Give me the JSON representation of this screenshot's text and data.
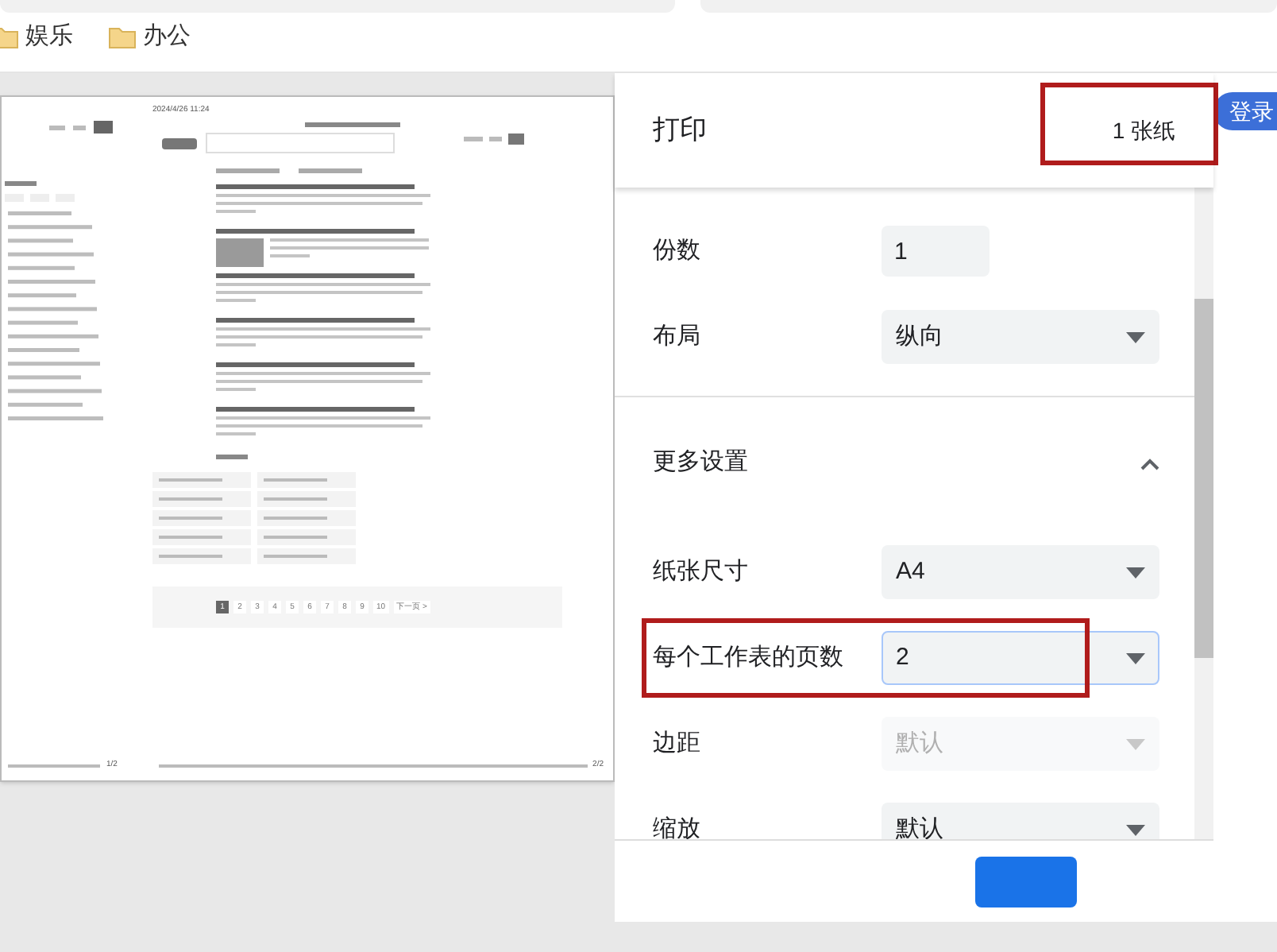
{
  "browser": {
    "bookmarks": [
      {
        "label": "娱乐"
      },
      {
        "label": "办公"
      }
    ],
    "login_button": "登录"
  },
  "preview": {
    "timestamp": "2024/4/26 11:24",
    "pagination": [
      {
        "label": "1",
        "selected": true
      },
      {
        "label": "2",
        "selected": false
      },
      {
        "label": "3",
        "selected": false
      },
      {
        "label": "4",
        "selected": false
      },
      {
        "label": "5",
        "selected": false
      },
      {
        "label": "6",
        "selected": false
      },
      {
        "label": "7",
        "selected": false
      },
      {
        "label": "8",
        "selected": false
      },
      {
        "label": "9",
        "selected": false
      },
      {
        "label": "10",
        "selected": false
      },
      {
        "label": "下一页 >",
        "selected": false
      }
    ],
    "page_numbers": [
      "1/2",
      "2/2"
    ]
  },
  "print_panel": {
    "title": "打印",
    "sheet_count": "1 张纸",
    "settings": [
      {
        "kind": "input",
        "label": "份数",
        "value": "1"
      },
      {
        "kind": "select",
        "label": "布局",
        "value": "纵向",
        "disabled": false,
        "focused": false
      },
      {
        "kind": "section",
        "label": "更多设置",
        "expanded": true
      },
      {
        "kind": "select",
        "label": "纸张尺寸",
        "value": "A4",
        "disabled": false,
        "focused": false
      },
      {
        "kind": "select",
        "label": "每个工作表的页数",
        "value": "2",
        "disabled": false,
        "focused": true
      },
      {
        "kind": "select",
        "label": "边距",
        "value": "默认",
        "disabled": true,
        "focused": false
      },
      {
        "kind": "select",
        "label": "缩放",
        "value": "默认",
        "disabled": false,
        "focused": false
      }
    ]
  }
}
